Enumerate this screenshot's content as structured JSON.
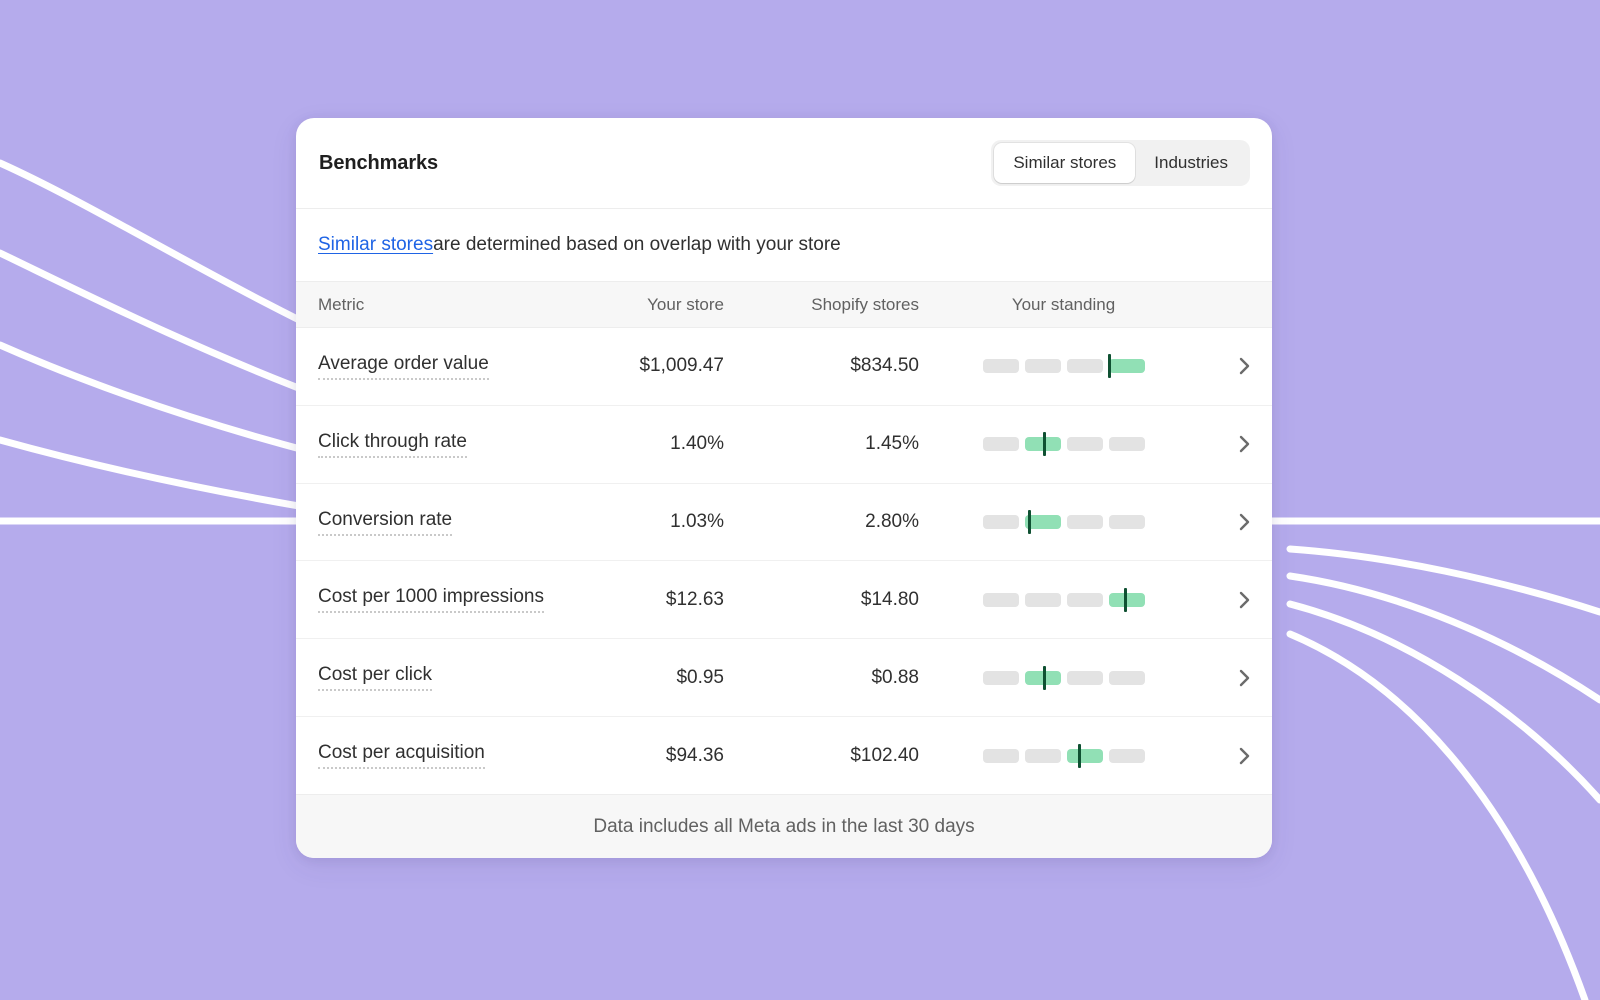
{
  "background": {
    "color": "#b5abec",
    "line_color": "#ffffff"
  },
  "card": {
    "header": {
      "title": "Benchmarks",
      "segmented_control": {
        "selected": "Similar stores",
        "options": [
          "Similar stores",
          "Industries"
        ]
      }
    },
    "subtitle": {
      "link_text": "Similar stores",
      "rest_text": " are determined based on overlap with your store"
    },
    "table": {
      "columns": [
        "Metric",
        "Your store",
        "Shopify stores",
        "Your standing"
      ],
      "rows": [
        {
          "metric": "Average order value",
          "your_store": "$1,009.47",
          "shopify_stores": "$834.50",
          "standing": {
            "segments": 4,
            "filled_index": 3,
            "marker_percent": 78.5
          },
          "chevron": "chevron-right-icon"
        },
        {
          "metric": "Click through rate",
          "your_store": "1.40%",
          "shopify_stores": "1.45%",
          "standing": {
            "segments": 4,
            "filled_index": 1,
            "marker_percent": 38.5
          },
          "chevron": "chevron-right-icon"
        },
        {
          "metric": "Conversion rate",
          "your_store": "1.03%",
          "shopify_stores": "2.80%",
          "standing": {
            "segments": 4,
            "filled_index": 1,
            "marker_percent": 29.0
          },
          "chevron": "chevron-right-icon"
        },
        {
          "metric": "Cost per 1000 impressions",
          "your_store": "$12.63",
          "shopify_stores": "$14.80",
          "standing": {
            "segments": 4,
            "filled_index": 3,
            "marker_percent": 88.0
          },
          "chevron": "chevron-right-icon"
        },
        {
          "metric": "Cost per click",
          "your_store": "$0.95",
          "shopify_stores": "$0.88",
          "standing": {
            "segments": 4,
            "filled_index": 1,
            "marker_percent": 38.5
          },
          "chevron": "chevron-right-icon"
        },
        {
          "metric": "Cost per acquisition",
          "your_store": "$94.36",
          "shopify_stores": "$102.40",
          "standing": {
            "segments": 4,
            "filled_index": 2,
            "marker_percent": 60.0
          },
          "chevron": "chevron-right-icon"
        }
      ]
    },
    "footer": {
      "note": "Data includes all Meta ads in the last 30 days"
    }
  },
  "colors": {
    "accent_link": "#1f64e5",
    "standing_filled": "#91e0b5",
    "standing_empty": "#e3e3e3",
    "marker": "#0f5132",
    "card_bg": "#ffffff",
    "header_row_bg": "#f7f7f7"
  }
}
